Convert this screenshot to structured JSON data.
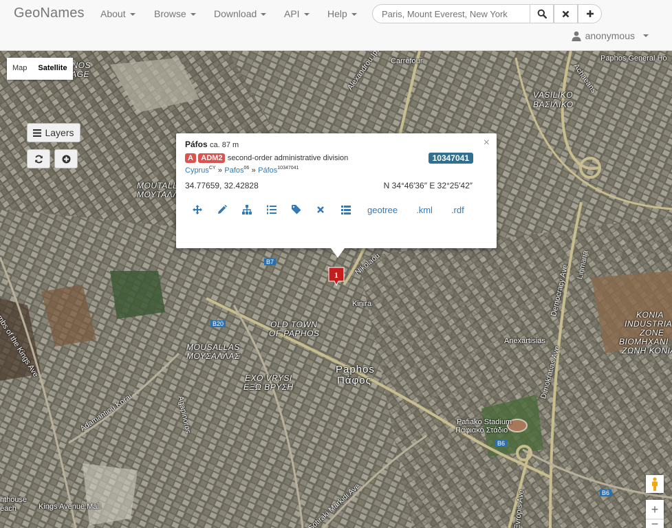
{
  "navbar": {
    "brand": "GeoNames",
    "menu": [
      {
        "label": "About"
      },
      {
        "label": "Browse"
      },
      {
        "label": "Download"
      },
      {
        "label": "API"
      },
      {
        "label": "Help"
      }
    ],
    "search_placeholder": "Paris, Mount Everest, New York",
    "user": "anonymous"
  },
  "map": {
    "type_buttons": [
      "Map",
      "Satellite"
    ],
    "active_type": "Satellite",
    "layers_label": "Layers",
    "marker_label": "1",
    "labels": {
      "carrefour": "Carrefour",
      "paphos_hospital": "Paphos General Ho",
      "vasiliko": "VASILIKO",
      "vasiliko_gr": "ΒΑΣΙΛΙΚΟ",
      "moutall": "MOUTALL",
      "moutall_gr": "ΜΟΥΤΑΛΛ",
      "old_town": "OLD TOWN",
      "of_paphos": "OF PAPHOS",
      "mousallas": "MOUSALLAS",
      "mousallas_gr": "ΜΟΥΣΑΛΛΑΣ",
      "exo_vrysi": "EXO VRYSI",
      "exo_vrysi_gr": "ΕΞΩ ΒΡΥΣΗ",
      "paphos": "Paphos",
      "paphos_gr": "Πάφος",
      "kinira": "Kinira",
      "anexartisias": "Anexartisias",
      "stadium": "Pafiako Stadium",
      "stadium_gr": "Παφιακό Στάδιο",
      "konia": "KONIA",
      "industrial": "INDUSTRIA",
      "zone": "ZONE",
      "viomichani": "ΒΙΟΜΗΧΑΝΙ",
      "zoni": "ΖΩΝΗ ΚΟΝΙΑ",
      "kings_mall": "Kings Avenue Mall",
      "lighthouse": "hthouse",
      "beach": "each",
      "anos": "ANOS",
      "lage": "LAGE",
      "tombs": "Tombs of the Kings Ave",
      "adamantiou": "Adamantiou Korai",
      "dimokratias": "Dimokratias Ave",
      "democracy": "Democracy Ave",
      "linmaria": "Linmaria",
      "evropis": "Evropis Ave",
      "sotiraki": "Sotiraki Markidi Ave",
      "nikolaou": "Nikolaou",
      "acheans": "Achaeans",
      "alexandrou": "Alexandrou Ipsil",
      "agapinoros": "Agapinoros",
      "b7": "B7",
      "b20": "B20",
      "b6": "B6",
      "b6b": "B6"
    }
  },
  "popup": {
    "name": "Páfos",
    "elevation": "ca. 87 m",
    "badge_a": "A",
    "badge_code": "ADM2",
    "feature": "second-order administrative division",
    "geonameid": "10347041",
    "hierarchy": [
      {
        "name": "Cyprus",
        "sup": "CY"
      },
      {
        "name": "Pafos",
        "sup": "06"
      },
      {
        "name": "Páfos",
        "sup": "10347041"
      }
    ],
    "sep": "»",
    "coords_decimal": "34.77659, 32.42828",
    "coords_dms": "N 34°46′36″ E 32°25′42″",
    "links": [
      "geotree",
      ".kml",
      ".rdf"
    ],
    "close": "×"
  },
  "controls": {
    "zoom_in": "+",
    "zoom_out": "−"
  }
}
